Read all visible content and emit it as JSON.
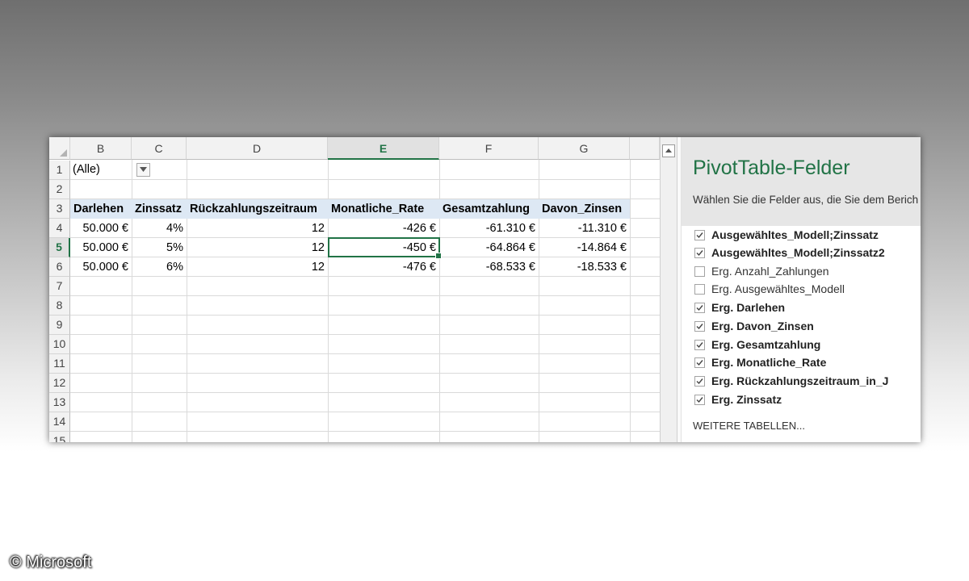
{
  "spreadsheet": {
    "columns": [
      "B",
      "C",
      "D",
      "E",
      "F",
      "G"
    ],
    "selected_column": "E",
    "rows": [
      "1",
      "2",
      "3",
      "4",
      "5",
      "6",
      "7",
      "8",
      "9",
      "10",
      "11",
      "12",
      "13",
      "14",
      "15"
    ],
    "selected_row": "5",
    "filter": {
      "value": "(Alle)"
    },
    "headers": [
      "Darlehen",
      "Zinssatz",
      "Rückzahlungszeitraum",
      "Monatliche_Rate",
      "Gesamtzahlung",
      "Davon_Zinsen"
    ],
    "data": [
      [
        "50.000 €",
        "4%",
        "12",
        "-426 €",
        "-61.310 €",
        "-11.310 €"
      ],
      [
        "50.000 €",
        "5%",
        "12",
        "-450 €",
        "-64.864 €",
        "-14.864 €"
      ],
      [
        "50.000 €",
        "6%",
        "12",
        "-476 €",
        "-68.533 €",
        "-18.533 €"
      ]
    ],
    "accent_color": "#217346",
    "header_fill_color": "#dde8f4"
  },
  "pivot_pane": {
    "title": "PivotTable-Felder",
    "subtitle": "Wählen Sie die Felder aus, die Sie dem Berich",
    "fields": [
      {
        "label": "Ausgewähltes_Modell;Zinssatz",
        "checked": true
      },
      {
        "label": "Ausgewähltes_Modell;Zinssatz2",
        "checked": true
      },
      {
        "label": "Erg. Anzahl_Zahlungen",
        "checked": false
      },
      {
        "label": "Erg. Ausgewähltes_Modell",
        "checked": false
      },
      {
        "label": "Erg. Darlehen",
        "checked": true
      },
      {
        "label": "Erg. Davon_Zinsen",
        "checked": true
      },
      {
        "label": "Erg. Gesamtzahlung",
        "checked": true
      },
      {
        "label": "Erg. Monatliche_Rate",
        "checked": true
      },
      {
        "label": "Erg. Rückzahlungszeitraum_in_J",
        "checked": true
      },
      {
        "label": "Erg. Zinssatz",
        "checked": true
      }
    ],
    "more_tables": "WEITERE TABELLEN..."
  },
  "copyright": "© Microsoft"
}
